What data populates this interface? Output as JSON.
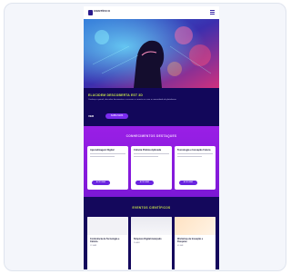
{
  "header": {
    "logo_text": "CIENTÍFICO"
  },
  "intro": {
    "title": "ELUCIDEM DESCOBERTA EST 3D",
    "text": "Conheça o painel, descubra ferramentas e recursos e conecte-se com a comunidade da plataforma.",
    "link_label": "VER",
    "button_label": "SAIBA MAIS"
  },
  "resources": {
    "title": "CONHECIMENTOS DESTAQUES",
    "cards": [
      {
        "title": "Aprendizagem Digital",
        "button_label": "ACESSAR"
      },
      {
        "title": "Ciência Prática Aplicada",
        "button_label": "ACESSAR"
      },
      {
        "title": "Tecnologia e Inovação Futura",
        "button_label": "ACESSAR"
      }
    ]
  },
  "events": {
    "title": "EVENTOS CIENTÍFICOS",
    "cards": [
      {
        "title": "Conferência de Tecnologia e Ciência",
        "date": "12 MAR"
      },
      {
        "title": "Simpósio Digital Avançado",
        "date": "20 ABR"
      },
      {
        "title": "Workshop de Inovação e Pesquisa",
        "date": "05 MAI"
      }
    ]
  },
  "colors": {
    "accent_lime": "#c8e64a",
    "brand_purple": "#7b2cf0",
    "navy": "#12075a",
    "magenta": "#9a1fe6"
  },
  "icons": {
    "menu": "hamburger-menu-icon",
    "logo": "brand-logo-icon"
  }
}
